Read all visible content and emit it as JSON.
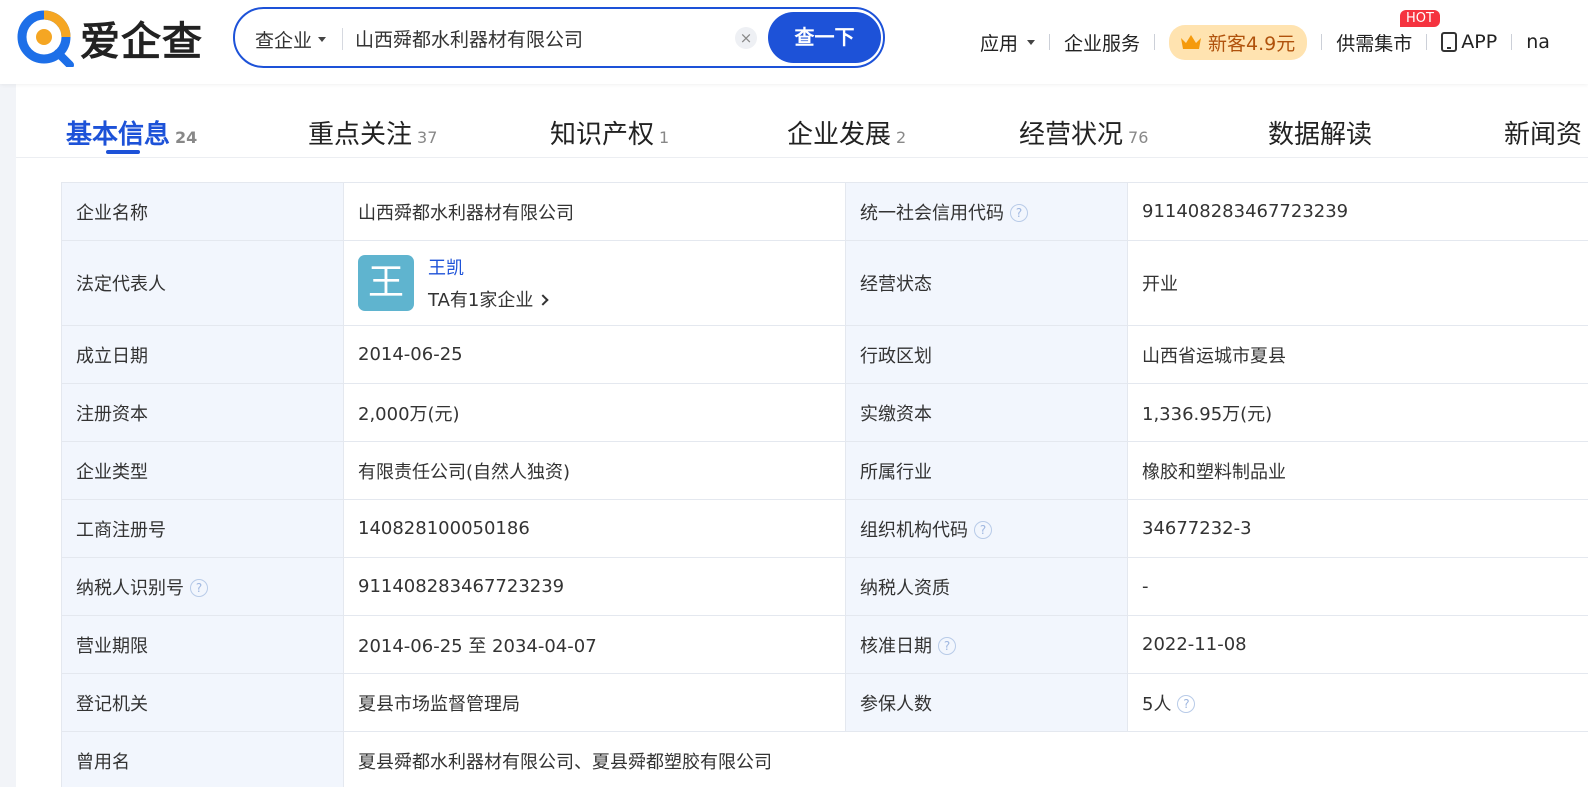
{
  "logo": {
    "text": "爱企查"
  },
  "search": {
    "type_label": "查企业",
    "query": "山西舜都水利器材有限公司",
    "clear_label": "×",
    "submit_label": "查一下"
  },
  "topnav": {
    "apps": "应用",
    "services": "企业服务",
    "promo": "新客4.9元",
    "market": "供需集市",
    "hot_badge": "HOT",
    "app": "APP",
    "user": "na"
  },
  "tabs": [
    {
      "label": "基本信息",
      "count": "24"
    },
    {
      "label": "重点关注",
      "count": "37"
    },
    {
      "label": "知识产权",
      "count": "1"
    },
    {
      "label": "企业发展",
      "count": "2"
    },
    {
      "label": "经营状况",
      "count": "76"
    },
    {
      "label": "数据解读",
      "count": ""
    },
    {
      "label": "新闻资",
      "count": ""
    }
  ],
  "info": {
    "company_name_label": "企业名称",
    "company_name": "山西舜都水利器材有限公司",
    "credit_code_label": "统一社会信用代码",
    "credit_code": "911408283467723239",
    "legal_rep_label": "法定代表人",
    "legal_rep_avatar": "王",
    "legal_rep_name": "王凯",
    "legal_rep_sub": "TA有1家企业",
    "status_label": "经营状态",
    "status": "开业",
    "founded_label": "成立日期",
    "founded": "2014-06-25",
    "region_label": "行政区划",
    "region": "山西省运城市夏县",
    "reg_capital_label": "注册资本",
    "reg_capital": "2,000万(元)",
    "paid_capital_label": "实缴资本",
    "paid_capital": "1,336.95万(元)",
    "type_label": "企业类型",
    "type": "有限责任公司(自然人独资)",
    "industry_label": "所属行业",
    "industry": "橡胶和塑料制品业",
    "reg_no_label": "工商注册号",
    "reg_no": "140828100050186",
    "org_code_label": "组织机构代码",
    "org_code": "34677232-3",
    "tax_id_label": "纳税人识别号",
    "tax_id": "911408283467723239",
    "tax_qual_label": "纳税人资质",
    "tax_qual": "-",
    "term_label": "营业期限",
    "term": "2014-06-25 至 2034-04-07",
    "approved_label": "核准日期",
    "approved": "2022-11-08",
    "authority_label": "登记机关",
    "authority": "夏县市场监督管理局",
    "insured_label": "参保人数",
    "insured": "5人",
    "former_names_label": "曾用名",
    "former_names": "夏县舜都水利器材有限公司、夏县舜都塑胶有限公司"
  },
  "colors": {
    "brand": "#1d52d8",
    "label_bg": "#f2f6fd",
    "avatar": "#5fb4cf",
    "promo_bg": "#ffe3b0",
    "hot": "#f5333f"
  }
}
